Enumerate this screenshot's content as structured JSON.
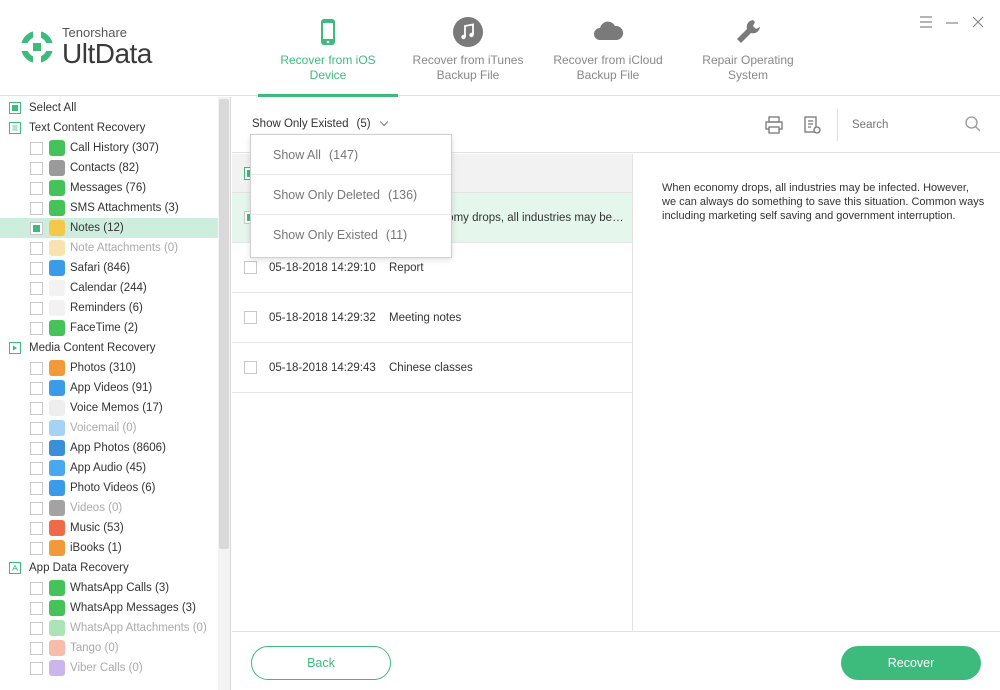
{
  "app": {
    "brand": "Tenorshare",
    "product": "UltData"
  },
  "colors": {
    "accent": "#3dbb7c",
    "selected_bg": "#cdeedd"
  },
  "nav": [
    {
      "label": "Recover from iOS Device",
      "icon": "phone-icon",
      "active": true
    },
    {
      "label": "Recover from iTunes Backup File",
      "icon": "music-note-icon",
      "active": false
    },
    {
      "label": "Recover from iCloud Backup File",
      "icon": "cloud-icon",
      "active": false
    },
    {
      "label": "Repair Operating System",
      "icon": "wrench-icon",
      "active": false
    }
  ],
  "window_controls": [
    "menu-icon",
    "minimize-icon",
    "close-icon"
  ],
  "sidebar": {
    "select_all": "Select All",
    "categories": [
      {
        "label": "Text Content Recovery",
        "items": [
          {
            "label": "Call History (307)",
            "icon": "phone-call-icon",
            "color": "#45c35a"
          },
          {
            "label": "Contacts (82)",
            "icon": "contacts-icon",
            "color": "#9a9a9a"
          },
          {
            "label": "Messages (76)",
            "icon": "messages-icon",
            "color": "#45c35a"
          },
          {
            "label": "SMS Attachments (3)",
            "icon": "attachment-icon",
            "color": "#45c35a"
          },
          {
            "label": "Notes (12)",
            "icon": "notes-icon",
            "color": "#f5c84a",
            "selected": true,
            "checked": true
          },
          {
            "label": "Note Attachments (0)",
            "icon": "note-attachment-icon",
            "color": "#f0c050",
            "dim": true
          },
          {
            "label": "Safari (846)",
            "icon": "safari-icon",
            "color": "#3a9be8"
          },
          {
            "label": "Calendar (244)",
            "icon": "calendar-icon",
            "color": "#f2f2f2"
          },
          {
            "label": "Reminders (6)",
            "icon": "reminders-icon",
            "color": "#f2f2f2"
          },
          {
            "label": "FaceTime (2)",
            "icon": "facetime-icon",
            "color": "#45c35a"
          }
        ]
      },
      {
        "label": "Media Content Recovery",
        "items": [
          {
            "label": "Photos (310)",
            "icon": "photos-icon",
            "color": "#f29a3a"
          },
          {
            "label": "App Videos (91)",
            "icon": "app-videos-icon",
            "color": "#3a9be8"
          },
          {
            "label": "Voice Memos (17)",
            "icon": "voice-memos-icon",
            "color": "#eeeeee"
          },
          {
            "label": "Voicemail (0)",
            "icon": "voicemail-icon",
            "color": "#3a9be8",
            "dim": true
          },
          {
            "label": "App Photos (8606)",
            "icon": "app-photos-icon",
            "color": "#3a8fd8"
          },
          {
            "label": "App Audio (45)",
            "icon": "app-audio-icon",
            "color": "#4aa8f0"
          },
          {
            "label": "Photo Videos (6)",
            "icon": "photo-videos-icon",
            "color": "#3a9be8"
          },
          {
            "label": "Videos (0)",
            "icon": "videos-icon",
            "color": "#333333",
            "dim": true
          },
          {
            "label": "Music (53)",
            "icon": "music-icon",
            "color": "#f06a4a"
          },
          {
            "label": "iBooks (1)",
            "icon": "ibooks-icon",
            "color": "#f29a3a"
          }
        ]
      },
      {
        "label": "App Data Recovery",
        "items": [
          {
            "label": "WhatsApp Calls (3)",
            "icon": "whatsapp-calls-icon",
            "color": "#45c35a"
          },
          {
            "label": "WhatsApp Messages (3)",
            "icon": "whatsapp-messages-icon",
            "color": "#45c35a"
          },
          {
            "label": "WhatsApp Attachments (0)",
            "icon": "whatsapp-attachments-icon",
            "color": "#45c35a",
            "dim": true
          },
          {
            "label": "Tango (0)",
            "icon": "tango-icon",
            "color": "#f06a4a",
            "dim": true
          },
          {
            "label": "Viber Calls (0)",
            "icon": "viber-calls-icon",
            "color": "#8a5ad8",
            "dim": true
          }
        ]
      }
    ]
  },
  "toolbar": {
    "filter_label": "Show Only Existed",
    "filter_count": "(5)",
    "search_placeholder": "Search"
  },
  "dropdown": {
    "options": [
      {
        "label": "Show All",
        "count": "(147)"
      },
      {
        "label": "Show Only Deleted",
        "count": "(136)"
      },
      {
        "label": "Show Only Existed",
        "count": "(11)"
      }
    ]
  },
  "list": {
    "rows": [
      {
        "date": "",
        "title": "When economy drops, all industries may be infe...",
        "selected": true,
        "checked": true
      },
      {
        "date": "05-18-2018 14:29:10",
        "title": "Report",
        "selected": false,
        "checked": false
      },
      {
        "date": "05-18-2018 14:29:32",
        "title": "Meeting notes",
        "selected": false,
        "checked": false
      },
      {
        "date": "05-18-2018 14:29:43",
        "title": "Chinese classes",
        "selected": false,
        "checked": false
      }
    ]
  },
  "preview": {
    "text": "When economy drops, all industries may be infected. However, we can always do something to save this situation. Common ways including marketing self saving and government interruption."
  },
  "footer": {
    "back_label": "Back",
    "recover_label": "Recover"
  }
}
